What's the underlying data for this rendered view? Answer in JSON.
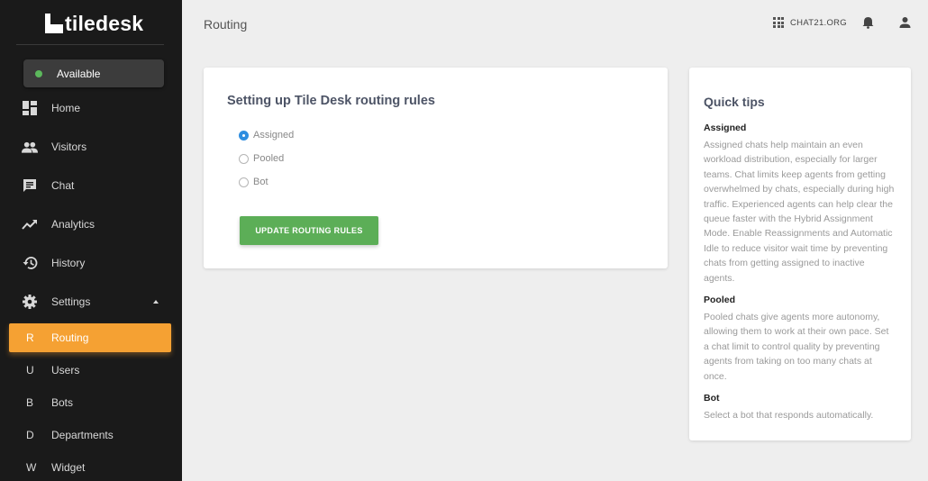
{
  "app": {
    "logo_text": "tiledesk"
  },
  "sidebar": {
    "status": {
      "label": "Available",
      "color": "#5cb85c"
    },
    "items": [
      {
        "label": "Home",
        "icon": "dashboard-icon"
      },
      {
        "label": "Visitors",
        "icon": "people-icon"
      },
      {
        "label": "Chat",
        "icon": "chat-icon"
      },
      {
        "label": "Analytics",
        "icon": "trending-up-icon"
      },
      {
        "label": "History",
        "icon": "history-icon"
      },
      {
        "label": "Settings",
        "icon": "gear-icon"
      }
    ],
    "settings_subitems": [
      {
        "letter": "R",
        "label": "Routing",
        "active": true
      },
      {
        "letter": "U",
        "label": "Users"
      },
      {
        "letter": "B",
        "label": "Bots"
      },
      {
        "letter": "D",
        "label": "Departments"
      },
      {
        "letter": "W",
        "label": "Widget"
      }
    ],
    "accent_color": "#f5a133"
  },
  "header": {
    "title": "Routing",
    "org_name": "CHAT21.ORG"
  },
  "routing_card": {
    "title": "Setting up Tile Desk routing rules",
    "options": [
      {
        "label": "Assigned",
        "checked": true
      },
      {
        "label": "Pooled",
        "checked": false
      },
      {
        "label": "Bot",
        "checked": false
      }
    ],
    "button_label": "UPDATE ROUTING RULES",
    "button_color": "#5cae57"
  },
  "tips": {
    "title": "Quick tips",
    "sections": [
      {
        "heading": "Assigned",
        "body": "Assigned chats help maintain an even workload distribution, especially for larger teams. Chat limits keep agents from getting overwhelmed by chats, especially during high traffic. Experienced agents can help clear the queue faster with the Hybrid Assignment Mode. Enable Reassignments and Automatic Idle to reduce visitor wait time by preventing chats from getting assigned to inactive agents."
      },
      {
        "heading": "Pooled",
        "body": "Pooled chats give agents more autonomy, allowing them to work at their own pace. Set a chat limit to control quality by preventing agents from taking on too many chats at once."
      },
      {
        "heading": "Bot",
        "body": "Select a bot that responds automatically."
      }
    ]
  }
}
